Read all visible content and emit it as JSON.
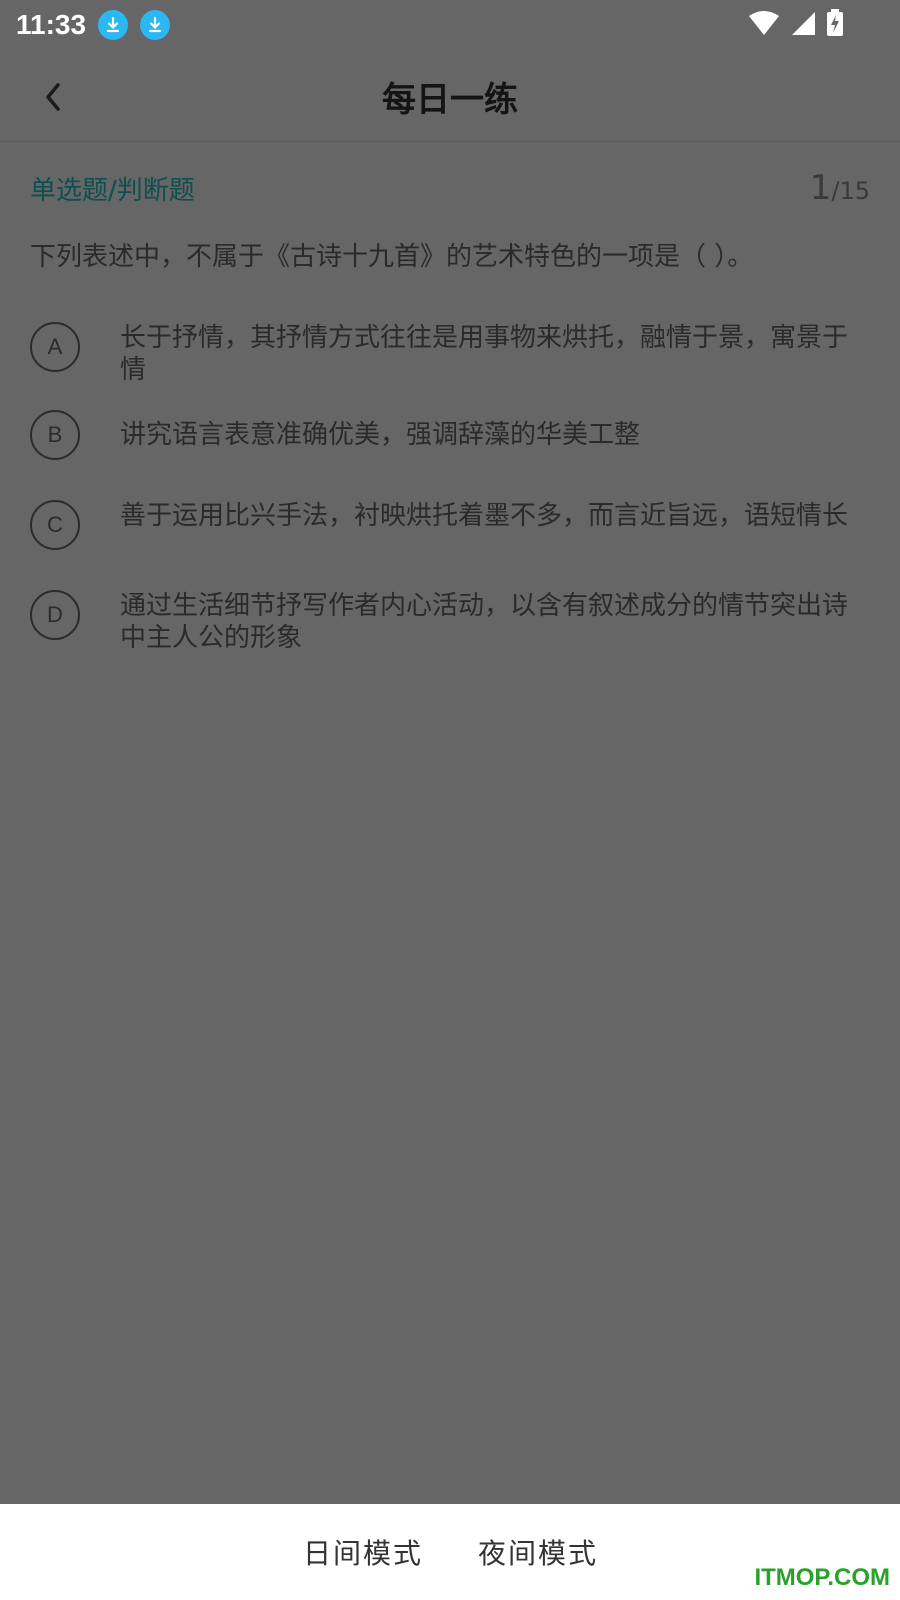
{
  "status_bar": {
    "time": "11:33",
    "icons": [
      "download-icon",
      "download-icon",
      "wifi-icon",
      "signal-icon",
      "battery-charging-icon"
    ]
  },
  "header": {
    "back_icon": "chevron-left-icon",
    "title": "每日一练"
  },
  "quiz": {
    "type_label": "单选题/判断题",
    "current": "1",
    "total": "/15",
    "question": "下列表述中，不属于《古诗十九首》的艺术特色的一项是（ ）。",
    "options": [
      {
        "letter": "A",
        "text": "长于抒情，其抒情方式往往是用事物来烘托，融情于景，寓景于情"
      },
      {
        "letter": "B",
        "text": "讲究语言表意准确优美，强调辞藻的华美工整"
      },
      {
        "letter": "C",
        "text": "善于运用比兴手法，衬映烘托着墨不多，而言近旨远，语短情长"
      },
      {
        "letter": "D",
        "text": "通过生活细节抒写作者内心活动，以含有叙述成分的情节突出诗中主人公的形象"
      }
    ]
  },
  "bottom_sheet": {
    "day_mode": "日间模式",
    "night_mode": "夜间模式"
  },
  "watermark": "ITMOP.COM",
  "colors": {
    "overlay": "#666666",
    "accent_download": "#2ab7f2",
    "type_label": "#0d4f4f",
    "watermark": "#2aa12a"
  }
}
